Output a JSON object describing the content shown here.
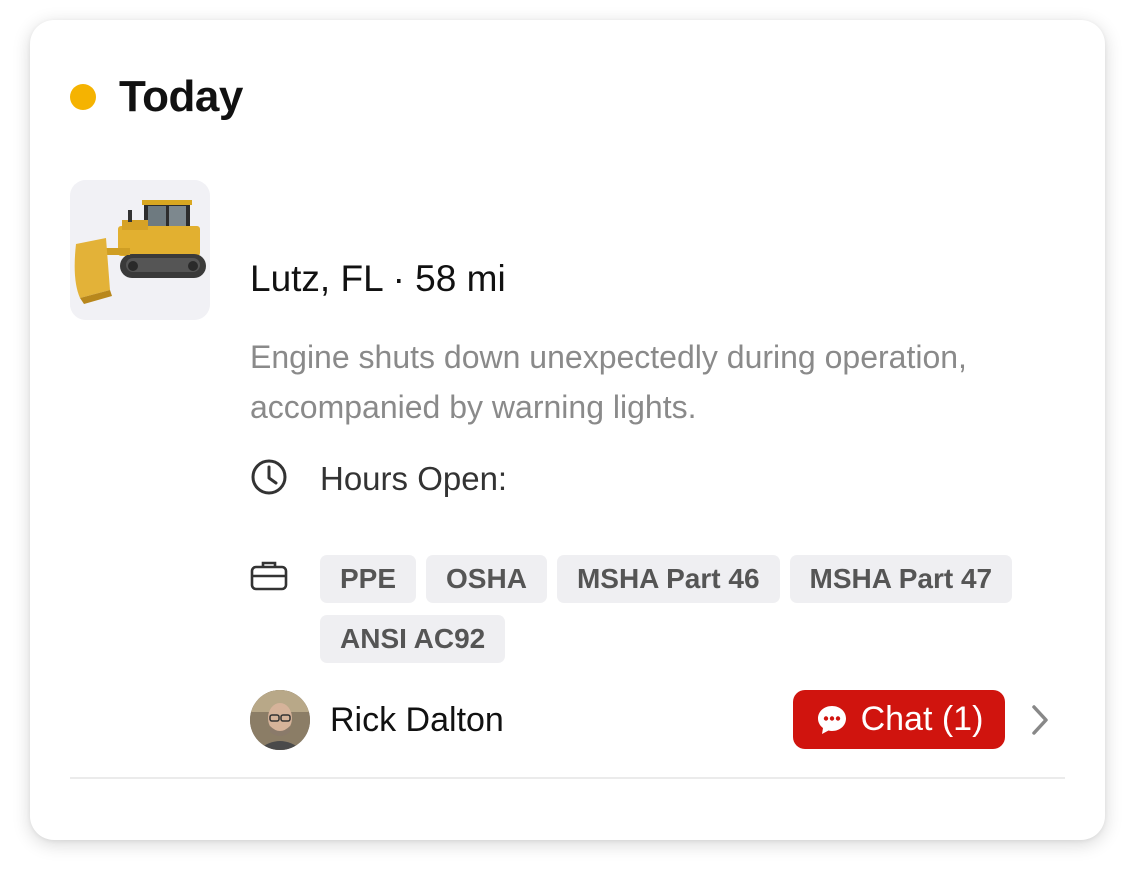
{
  "header": {
    "title": "Today",
    "status_color": "#F5B301"
  },
  "job": {
    "image_icon": "bulldozer-photo",
    "location": "Lutz, FL · 58 mi",
    "description": "Engine shuts down unexpectedly during operation, accompanied by warning lights.",
    "hours_label": "Hours Open:",
    "hours_icon": "clock-icon",
    "requirements_icon": "briefcase-icon",
    "requirements": [
      "PPE",
      "OSHA",
      "MSHA Part 46",
      "MSHA Part 47",
      "ANSI AC92"
    ]
  },
  "contact": {
    "name": "Rick Dalton",
    "avatar_icon": "avatar-photo"
  },
  "chat": {
    "label": "Chat (1)",
    "color": "#D0140E",
    "icon": "chat-bubble-icon"
  },
  "navigation": {
    "icon": "chevron-right-icon"
  }
}
